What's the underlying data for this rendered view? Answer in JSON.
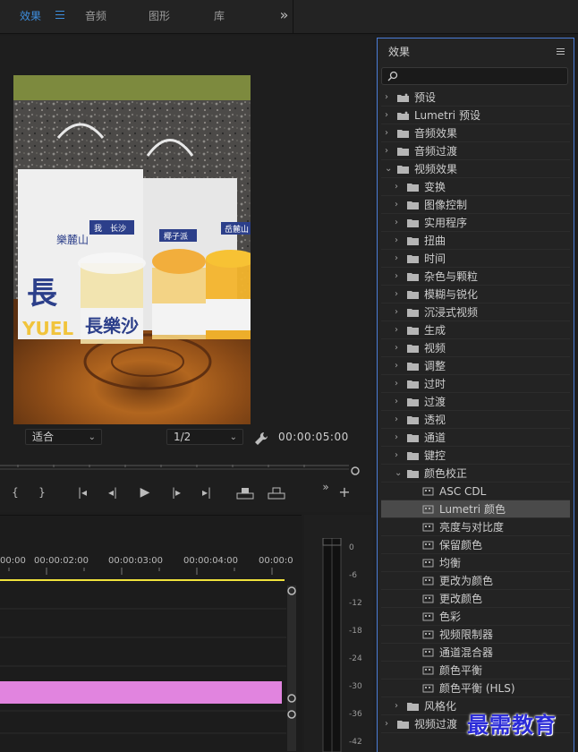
{
  "topbar": {
    "tabs": [
      {
        "label": "效果",
        "active": true
      },
      {
        "label": "音频",
        "active": false
      },
      {
        "label": "图形",
        "active": false
      },
      {
        "label": "库",
        "active": false
      }
    ],
    "overflow_label": "»"
  },
  "monitor": {
    "fit_select": "适合",
    "resolution_select": "1/2",
    "timecode": "00:00:05:00",
    "transport_icons": [
      "mark-in-icon",
      "mark-out-icon",
      "go-to-in-icon",
      "step-back-icon",
      "play-icon",
      "step-forward-icon",
      "go-to-out-icon",
      "lift-icon",
      "extract-icon"
    ],
    "more_label": "»",
    "add_label": "+"
  },
  "timeline": {
    "ruler": [
      "00:00",
      "00:00:02:00",
      "00:00:03:00",
      "00:00:04:00",
      "00:00:0"
    ],
    "clip_color": "#e184df",
    "playhead_color": "#f0e23c"
  },
  "meters": {
    "scale": [
      "0",
      "-6",
      "-12",
      "-18",
      "-24",
      "-30",
      "-36",
      "-42"
    ]
  },
  "effects": {
    "title": "效果",
    "search_placeholder": "",
    "items": [
      {
        "label": "预设",
        "level": 0,
        "expanded": false,
        "icon": "preset-folder-icon"
      },
      {
        "label": "Lumetri 预设",
        "level": 0,
        "expanded": false,
        "icon": "preset-folder-icon"
      },
      {
        "label": "音频效果",
        "level": 0,
        "expanded": false,
        "icon": "folder-icon"
      },
      {
        "label": "音频过渡",
        "level": 0,
        "expanded": false,
        "icon": "folder-icon"
      },
      {
        "label": "视频效果",
        "level": 0,
        "expanded": true,
        "icon": "folder-icon"
      },
      {
        "label": "变换",
        "level": 1,
        "expanded": false,
        "icon": "folder-icon"
      },
      {
        "label": "图像控制",
        "level": 1,
        "expanded": false,
        "icon": "folder-icon"
      },
      {
        "label": "实用程序",
        "level": 1,
        "expanded": false,
        "icon": "folder-icon"
      },
      {
        "label": "扭曲",
        "level": 1,
        "expanded": false,
        "icon": "folder-icon"
      },
      {
        "label": "时间",
        "level": 1,
        "expanded": false,
        "icon": "folder-icon"
      },
      {
        "label": "杂色与颗粒",
        "level": 1,
        "expanded": false,
        "icon": "folder-icon"
      },
      {
        "label": "模糊与锐化",
        "level": 1,
        "expanded": false,
        "icon": "folder-icon"
      },
      {
        "label": "沉浸式视频",
        "level": 1,
        "expanded": false,
        "icon": "folder-icon"
      },
      {
        "label": "生成",
        "level": 1,
        "expanded": false,
        "icon": "folder-icon"
      },
      {
        "label": "视频",
        "level": 1,
        "expanded": false,
        "icon": "folder-icon"
      },
      {
        "label": "调整",
        "level": 1,
        "expanded": false,
        "icon": "folder-icon"
      },
      {
        "label": "过时",
        "level": 1,
        "expanded": false,
        "icon": "folder-icon"
      },
      {
        "label": "过渡",
        "level": 1,
        "expanded": false,
        "icon": "folder-icon"
      },
      {
        "label": "透视",
        "level": 1,
        "expanded": false,
        "icon": "folder-icon"
      },
      {
        "label": "通道",
        "level": 1,
        "expanded": false,
        "icon": "folder-icon"
      },
      {
        "label": "键控",
        "level": 1,
        "expanded": false,
        "icon": "folder-icon"
      },
      {
        "label": "颜色校正",
        "level": 1,
        "expanded": true,
        "icon": "folder-icon"
      },
      {
        "label": "ASC CDL",
        "level": 2,
        "icon": "effect-icon"
      },
      {
        "label": "Lumetri 颜色",
        "level": 2,
        "icon": "effect-icon",
        "selected": true
      },
      {
        "label": "亮度与对比度",
        "level": 2,
        "icon": "effect-icon"
      },
      {
        "label": "保留颜色",
        "level": 2,
        "icon": "effect-icon"
      },
      {
        "label": "均衡",
        "level": 2,
        "icon": "effect-icon"
      },
      {
        "label": "更改为颜色",
        "level": 2,
        "icon": "effect-icon"
      },
      {
        "label": "更改颜色",
        "level": 2,
        "icon": "effect-icon"
      },
      {
        "label": "色彩",
        "level": 2,
        "icon": "effect-icon"
      },
      {
        "label": "视频限制器",
        "level": 2,
        "icon": "effect-icon"
      },
      {
        "label": "通道混合器",
        "level": 2,
        "icon": "effect-icon"
      },
      {
        "label": "颜色平衡",
        "level": 2,
        "icon": "effect-icon"
      },
      {
        "label": "颜色平衡 (HLS)",
        "level": 2,
        "icon": "effect-icon"
      },
      {
        "label": "风格化",
        "level": 1,
        "expanded": false,
        "icon": "folder-icon"
      },
      {
        "label": "视频过渡",
        "level": 0,
        "expanded": false,
        "icon": "folder-icon"
      }
    ]
  },
  "video": {
    "cup_labels": [
      "我",
      "长沙",
      "椰子派",
      "岳麓山"
    ],
    "brand": "長樂沙",
    "bag_text": "樂麓山",
    "bag_brand": "長",
    "bag_sub": "YUEL"
  },
  "watermark": "最需教育"
}
